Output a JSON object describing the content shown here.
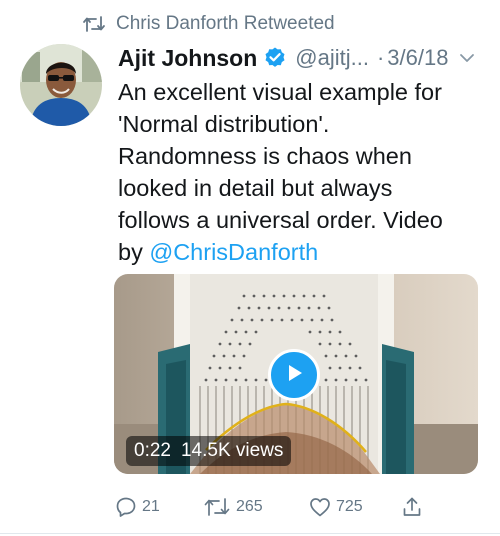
{
  "retweet": {
    "icon": "retweet-icon",
    "label": "Chris Danforth Retweeted"
  },
  "tweet": {
    "author": {
      "display_name": "Ajit Johnson",
      "handle": "@ajitj...",
      "verified_icon": "verified-badge-icon",
      "avatar_icon": "avatar"
    },
    "separator": "·",
    "date": "3/6/18",
    "more_icon": "chevron-down-icon",
    "text_lines": [
      "An excellent visual example for",
      "'Normal distribution'.",
      "Randomness is chaos when",
      "looked in detail but always",
      "follows a universal order. Video"
    ],
    "text_last_prefix": "by ",
    "mention": "@ChrisDanforth"
  },
  "media": {
    "duration": "0:22",
    "views": "14.5K views",
    "play_icon": "play-icon"
  },
  "actions": {
    "reply": {
      "icon": "reply-icon",
      "count": "21"
    },
    "retweet": {
      "icon": "retweet-icon",
      "count": "265"
    },
    "like": {
      "icon": "heart-icon",
      "count": "725"
    },
    "share": {
      "icon": "share-icon"
    }
  },
  "colors": {
    "accent": "#1da1f2",
    "text": "#14171a",
    "secondary": "#657786"
  }
}
